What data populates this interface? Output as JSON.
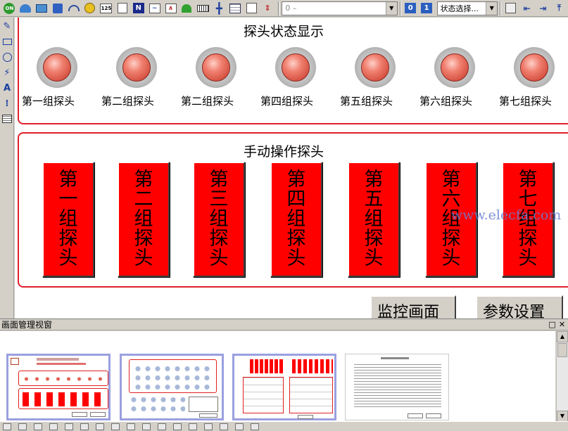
{
  "toolbar": {
    "layer_combo": "0 –",
    "num0": "0",
    "num1": "1",
    "state_select": "状态选择..."
  },
  "canvas": {
    "probe_status_title": "探头状态显示",
    "lamps": [
      {
        "label": "第一组探头"
      },
      {
        "label": "第二组探头"
      },
      {
        "label": "第二组探头"
      },
      {
        "label": "第四组探头"
      },
      {
        "label": "第五组探头"
      },
      {
        "label": "第六组探头"
      },
      {
        "label": "第七组探头"
      }
    ],
    "manual_title": "手动操作探头",
    "buttons": [
      {
        "label": "第一组探头"
      },
      {
        "label": "第二组探头"
      },
      {
        "label": "第三组探头"
      },
      {
        "label": "第四组探头"
      },
      {
        "label": "第五组探头"
      },
      {
        "label": "第六组探头"
      },
      {
        "label": "第七组探头"
      }
    ],
    "watermark": "www.elecfa.com",
    "monitor_button": "监控画面",
    "params_button": "参数设置"
  },
  "manager": {
    "title": "画面管理视窗",
    "restore_icon": "□",
    "close_icon": "✕"
  },
  "colors": {
    "panel_border": "#e0202a",
    "button_red": "#ff0000",
    "thumb_border": "#9aa0e0"
  }
}
